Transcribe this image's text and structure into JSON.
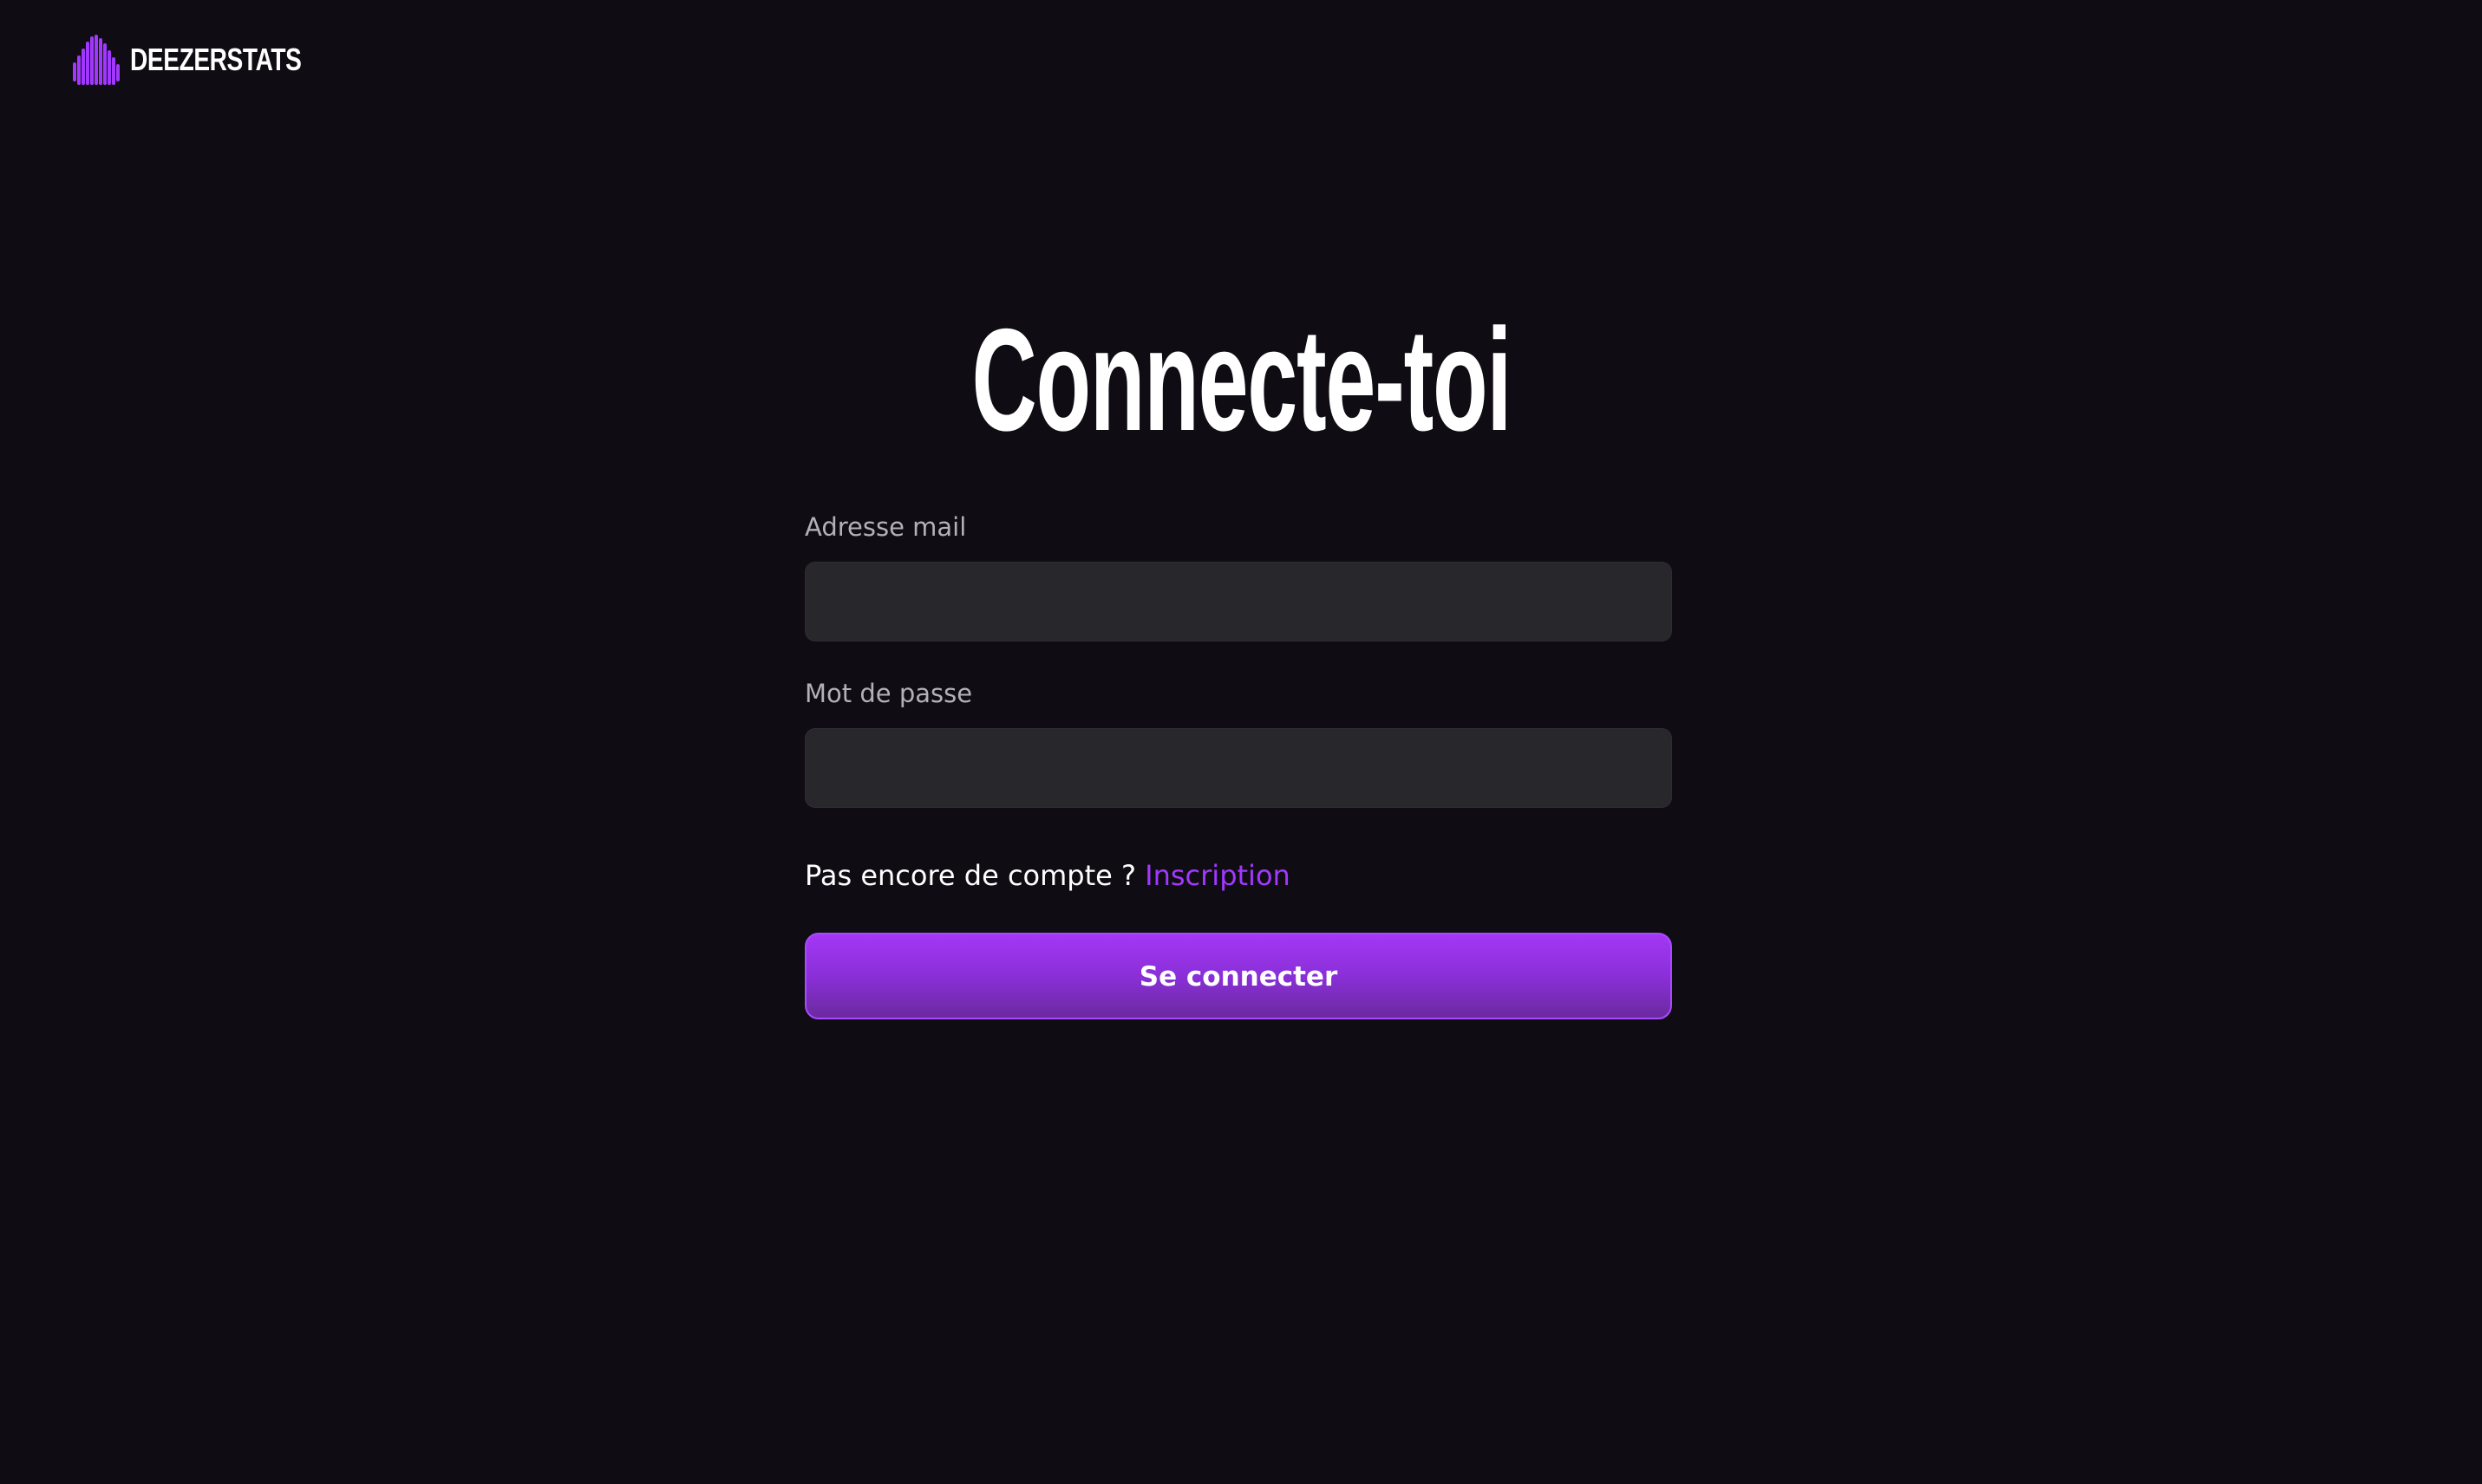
{
  "brand": {
    "name": "DEEZERSTATS",
    "logo_icon": "flame-logo-icon",
    "accent_color": "#a238ff"
  },
  "login": {
    "title": "Connecte-toi",
    "email_label": "Adresse mail",
    "email_value": "",
    "password_label": "Mot de passe",
    "password_value": "",
    "no_account_text": "Pas encore de compte ?",
    "signup_link": "Inscription",
    "submit_label": "Se connecter"
  },
  "colors": {
    "background": "#0f0d13",
    "input_background": "#28272c",
    "button_gradient_top": "#a437f5",
    "button_gradient_bottom": "#6b2a9f"
  }
}
